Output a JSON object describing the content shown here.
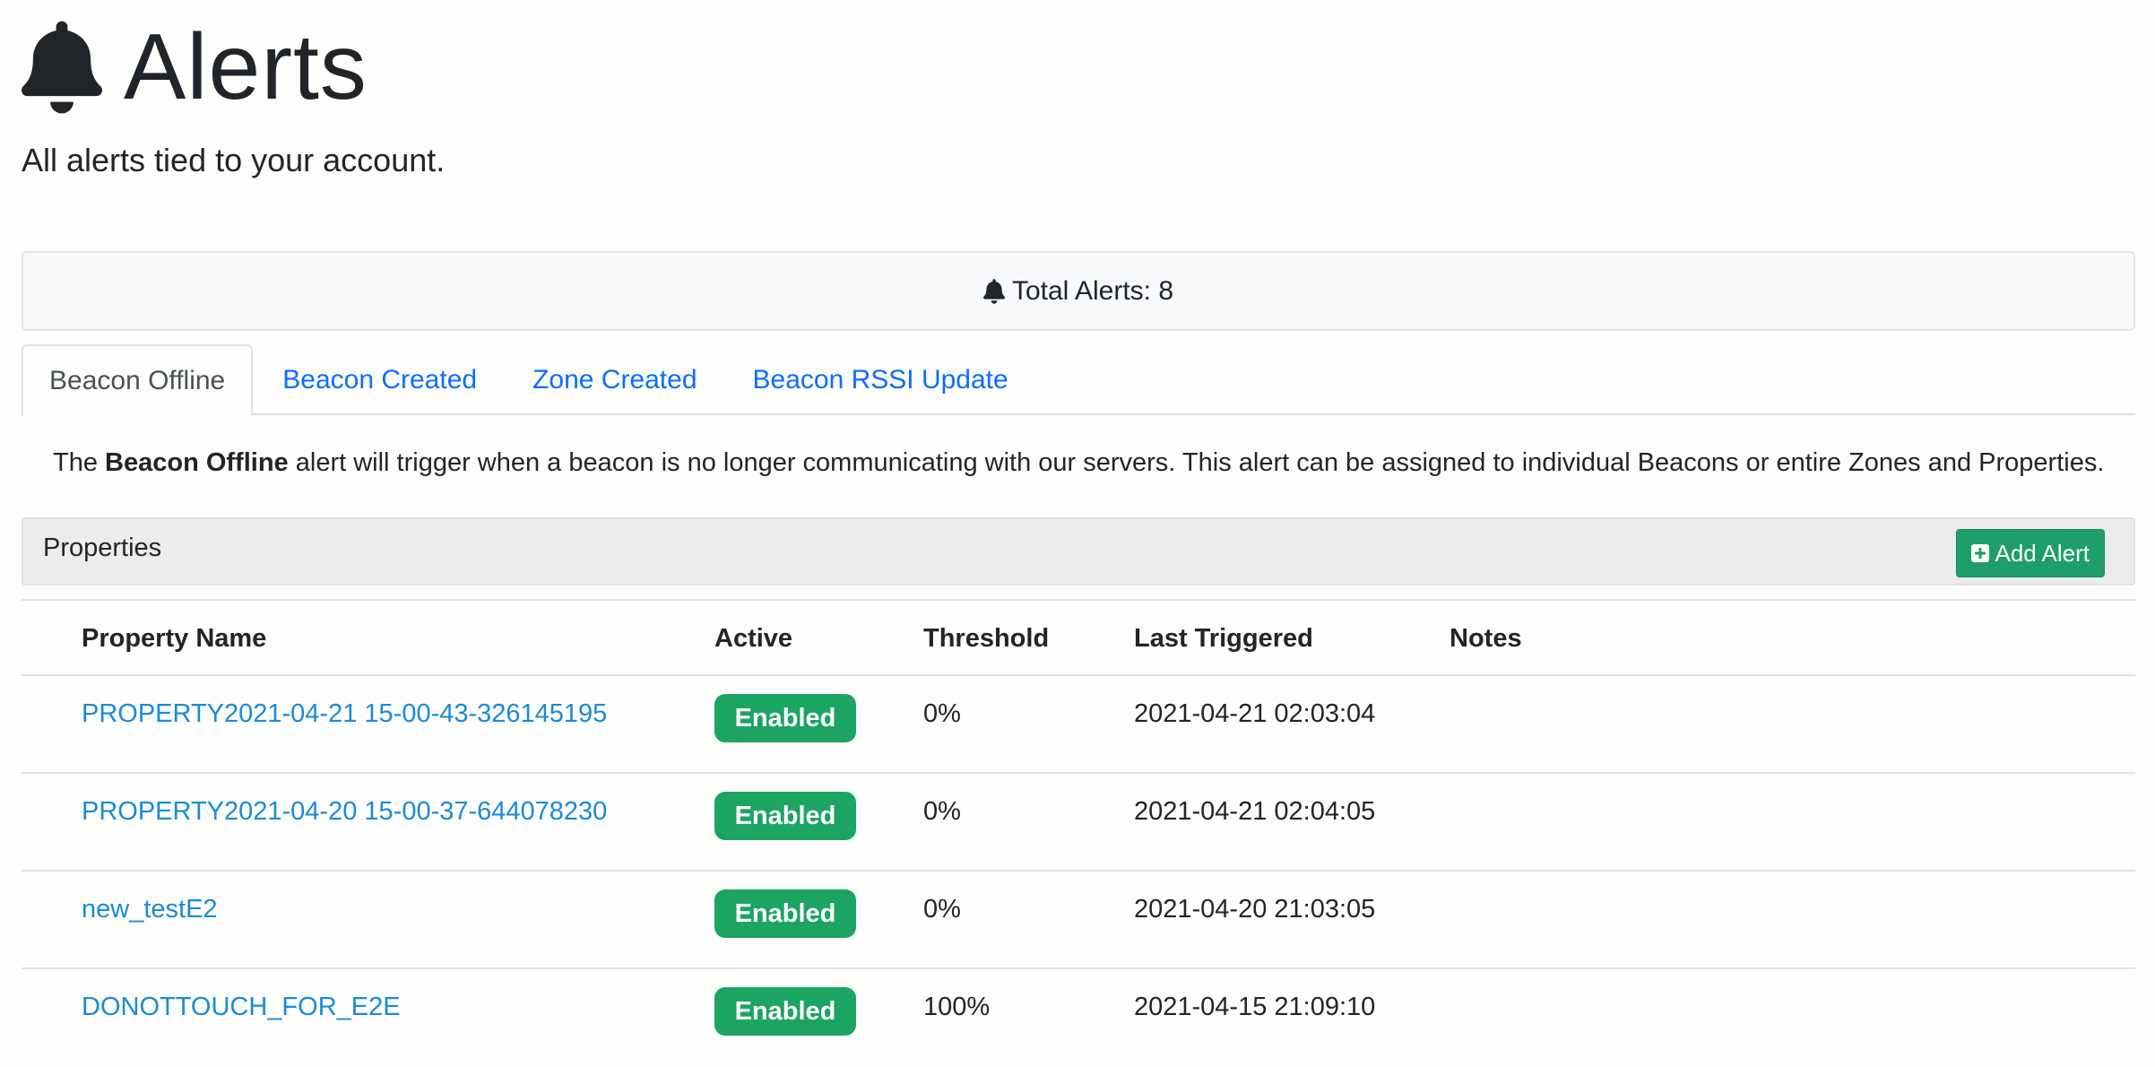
{
  "header": {
    "title": "Alerts",
    "subtitle": "All alerts tied to your account."
  },
  "summary": {
    "total_label": "Total Alerts: 8"
  },
  "tabs": [
    {
      "label": "Beacon Offline",
      "active": true
    },
    {
      "label": "Beacon Created",
      "active": false
    },
    {
      "label": "Zone Created",
      "active": false
    },
    {
      "label": "Beacon RSSI Update",
      "active": false
    }
  ],
  "description": {
    "prefix": "The ",
    "bold": "Beacon Offline",
    "suffix": " alert will trigger when a beacon is no longer communicating with our servers. This alert can be assigned to individual Beacons or entire Zones and Properties."
  },
  "properties_card": {
    "title": "Properties",
    "add_button_label": "Add Alert"
  },
  "table": {
    "columns": [
      "Property Name",
      "Active",
      "Threshold",
      "Last Triggered",
      "Notes"
    ],
    "rows": [
      {
        "name": "PROPERTY2021-04-21 15-00-43-326145195",
        "active": "Enabled",
        "threshold": "0%",
        "last_triggered": "2021-04-21 02:03:04",
        "notes": ""
      },
      {
        "name": "PROPERTY2021-04-20 15-00-37-644078230",
        "active": "Enabled",
        "threshold": "0%",
        "last_triggered": "2021-04-21 02:04:05",
        "notes": ""
      },
      {
        "name": "new_testE2",
        "active": "Enabled",
        "threshold": "0%",
        "last_triggered": "2021-04-20 21:03:05",
        "notes": ""
      },
      {
        "name": "DONOTTOUCH_FOR_E2E",
        "active": "Enabled",
        "threshold": "100%",
        "last_triggered": "2021-04-15 21:09:10",
        "notes": ""
      }
    ]
  },
  "colors": {
    "link": "#1a8bd6",
    "tab_link": "#0d6efd",
    "success_badge": "#1ba462",
    "add_button": "#1e9e6a"
  },
  "icons": {
    "title_icon": "bell-icon",
    "total_icon": "bell-icon",
    "add_icon": "plus-square-icon"
  }
}
